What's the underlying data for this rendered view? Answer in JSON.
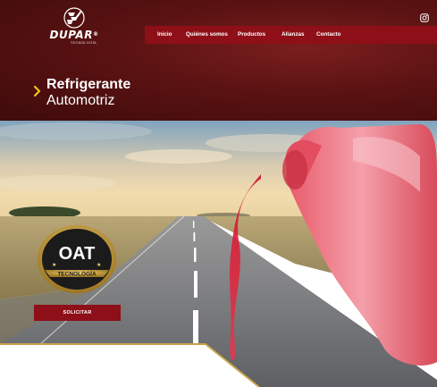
{
  "brand": {
    "name": "DUPAR",
    "registered": "®",
    "tagline": "TECNOLOGÍA"
  },
  "nav": {
    "items": [
      {
        "label": "Inicio"
      },
      {
        "label": "Quiénes somos"
      },
      {
        "label": "Productos"
      },
      {
        "label": "Alianzas"
      },
      {
        "label": "Contacto"
      }
    ]
  },
  "social": {
    "icon": "instagram-icon"
  },
  "page": {
    "title": "Refrigerante",
    "subtitle": "Automotriz"
  },
  "badge": {
    "line1": "OAT",
    "line2": "TECNOLOGÍA"
  },
  "cta": {
    "label": "SOLICITAR"
  },
  "colors": {
    "primary": "#8e0f17",
    "header_bg": "#5a1212",
    "accent": "#f2c21b",
    "gold": "#c9a14a"
  }
}
